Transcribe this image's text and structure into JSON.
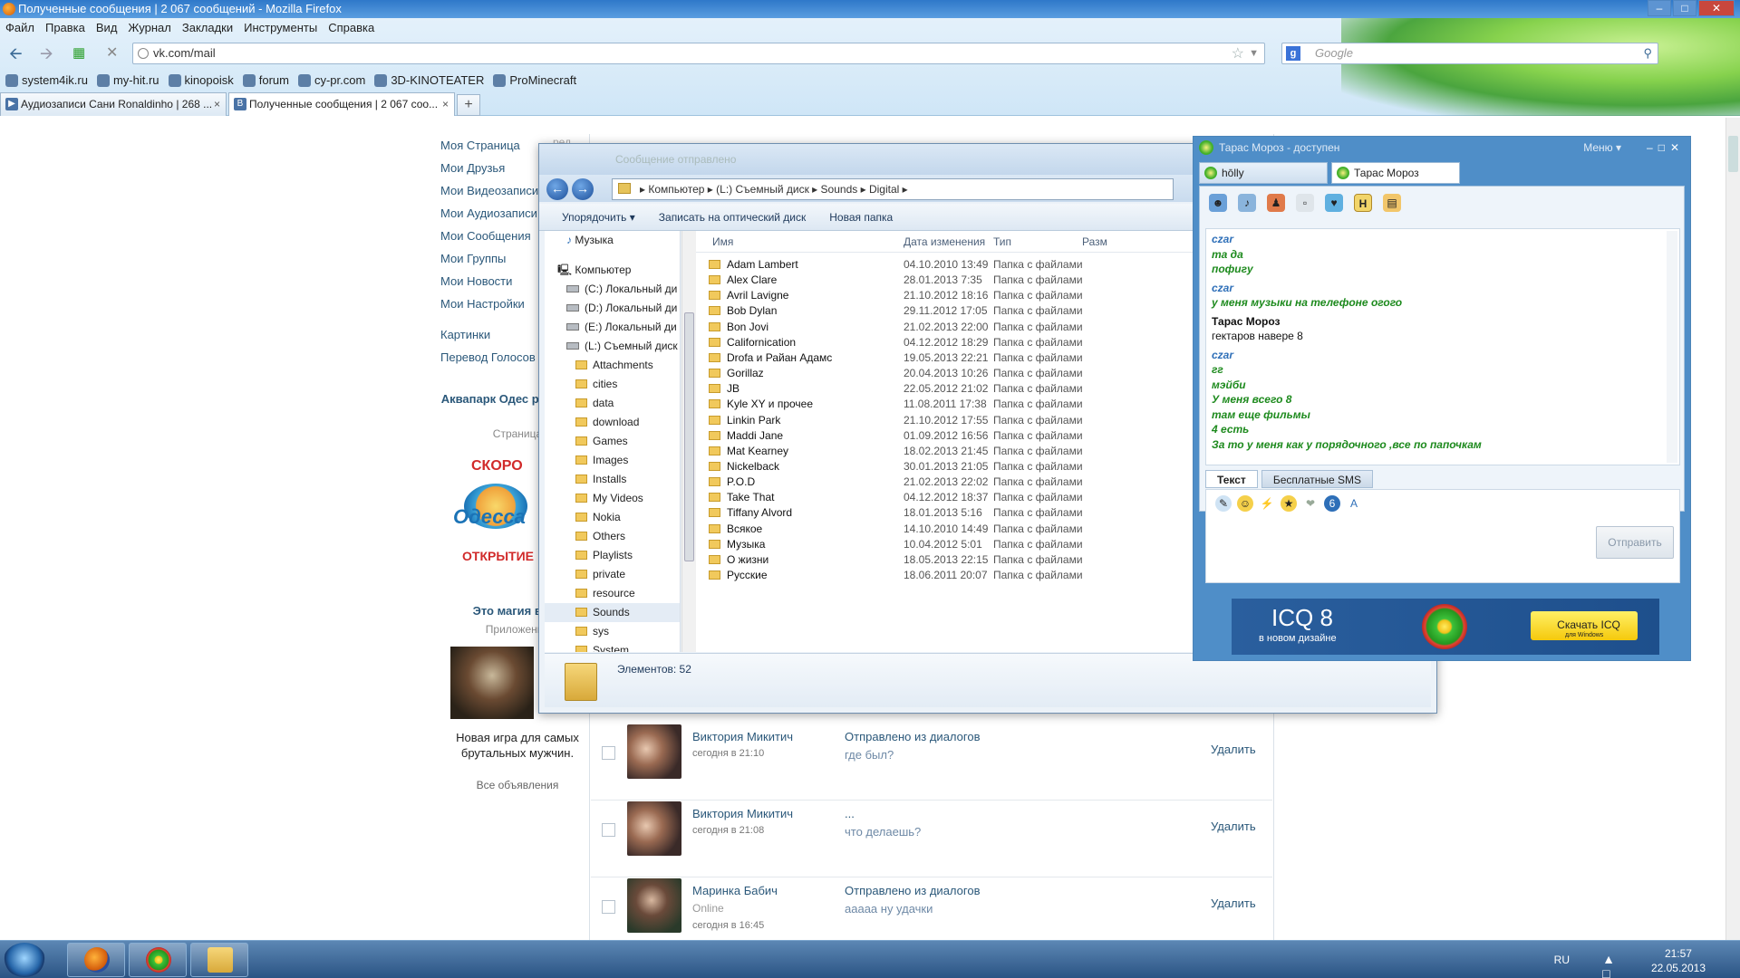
{
  "browser": {
    "window_title": "Полученные сообщения | 2 067 сообщений - Mozilla Firefox",
    "menu": [
      "Файл",
      "Правка",
      "Вид",
      "Журнал",
      "Закладки",
      "Инструменты",
      "Справка"
    ],
    "url": "vk.com/mail",
    "search_placeholder": "Google",
    "bookmarks": [
      "system4ik.ru",
      "my-hit.ru",
      "kinopoisk",
      "forum",
      "cy-pr.com",
      "3D-KINOTEATER",
      "ProMinecraft"
    ],
    "tabs": [
      {
        "label": "Аудиозаписи Сани Ronaldinho | 268 ...",
        "active": false
      },
      {
        "label": "Полученные сообщения | 2 067 соо...",
        "active": true
      }
    ],
    "new_tab": "+"
  },
  "vk": {
    "nav": [
      "Моя Страница",
      "Мои Друзья",
      "Мои Видеозаписи",
      "Мои Аудиозаписи",
      "Мои Сообщения",
      "Мои Группы",
      "Мои Новости",
      "Мои Настройки"
    ],
    "nav2": [
      "Картинки",
      "Перевод Голосов"
    ],
    "partial_tab": "ред",
    "ad1": {
      "title": "Аквапарк Одес розыгрыш",
      "sub": "Страница",
      "img_top": "СКОРО",
      "img_mid": "Одесса",
      "img_bot": "ОТКРЫТИЕ"
    },
    "ad2": {
      "title": "Это магия влас",
      "sub": "Приложение",
      "text": "Новая игра для самых брутальных мужчин."
    },
    "all_ads": "Все объявления",
    "messages": [
      {
        "name": "Виктория Микитич",
        "status": "",
        "time": "сегодня в 21:10",
        "subject": "Отправлено из диалогов",
        "preview": "где был?",
        "delete": "Удалить"
      },
      {
        "name": "Виктория Микитич",
        "status": "",
        "time": "сегодня в 21:08",
        "subject": "...",
        "preview": "что делаешь?",
        "delete": "Удалить"
      },
      {
        "name": "Маринка Бабич",
        "status": "Online",
        "time": "сегодня в 16:45",
        "subject": "Отправлено из диалогов",
        "preview": "ааааа ну удачки",
        "delete": "Удалить"
      }
    ]
  },
  "explorer": {
    "title": "Сообщение отправлено",
    "address": [
      "Компьютер",
      "(L:) Съемный диск",
      "Sounds",
      "Digital"
    ],
    "toolbar": [
      "Упорядочить ▾",
      "Записать на оптический диск",
      "Новая папка"
    ],
    "tree": [
      {
        "label": "Музыка",
        "kind": "music",
        "indent": 1
      },
      {
        "label": "",
        "kind": "gap",
        "indent": 0
      },
      {
        "label": "Компьютер",
        "kind": "computer",
        "indent": 0
      },
      {
        "label": "(C:) Локальный ди",
        "kind": "drive",
        "indent": 1
      },
      {
        "label": "(D:) Локальный ди",
        "kind": "drive",
        "indent": 1
      },
      {
        "label": "(E:) Локальный ди",
        "kind": "drive",
        "indent": 1
      },
      {
        "label": "(L:) Съемный диск",
        "kind": "drive",
        "indent": 1
      },
      {
        "label": "Attachments",
        "kind": "folder",
        "indent": 2
      },
      {
        "label": "cities",
        "kind": "folder",
        "indent": 2
      },
      {
        "label": "data",
        "kind": "folder",
        "indent": 2
      },
      {
        "label": "download",
        "kind": "folder",
        "indent": 2
      },
      {
        "label": "Games",
        "kind": "folder",
        "indent": 2
      },
      {
        "label": "Images",
        "kind": "folder",
        "indent": 2
      },
      {
        "label": "Installs",
        "kind": "folder",
        "indent": 2
      },
      {
        "label": "My Videos",
        "kind": "folder",
        "indent": 2
      },
      {
        "label": "Nokia",
        "kind": "folder",
        "indent": 2
      },
      {
        "label": "Others",
        "kind": "folder",
        "indent": 2
      },
      {
        "label": "Playlists",
        "kind": "folder",
        "indent": 2
      },
      {
        "label": "private",
        "kind": "folder",
        "indent": 2
      },
      {
        "label": "resource",
        "kind": "folder",
        "indent": 2
      },
      {
        "label": "Sounds",
        "kind": "folder",
        "indent": 2,
        "selected": true
      },
      {
        "label": "sys",
        "kind": "folder",
        "indent": 2
      },
      {
        "label": "System",
        "kind": "folder",
        "indent": 2
      }
    ],
    "columns": [
      "Имя",
      "Дата изменения",
      "Тип",
      "Разм"
    ],
    "files": [
      {
        "name": "Adam Lambert",
        "date": "04.10.2010 13:49",
        "type": "Папка с файлами"
      },
      {
        "name": "Alex Clare",
        "date": "28.01.2013 7:35",
        "type": "Папка с файлами"
      },
      {
        "name": "Avril Lavigne",
        "date": "21.10.2012 18:16",
        "type": "Папка с файлами"
      },
      {
        "name": "Bob Dylan",
        "date": "29.11.2012 17:05",
        "type": "Папка с файлами"
      },
      {
        "name": "Bon Jovi",
        "date": "21.02.2013 22:00",
        "type": "Папка с файлами"
      },
      {
        "name": "Californication",
        "date": "04.12.2012 18:29",
        "type": "Папка с файлами"
      },
      {
        "name": "Drofa и Райан Адамс",
        "date": "19.05.2013 22:21",
        "type": "Папка с файлами"
      },
      {
        "name": "Gorillaz",
        "date": "20.04.2013 10:26",
        "type": "Папка с файлами"
      },
      {
        "name": "JB",
        "date": "22.05.2012 21:02",
        "type": "Папка с файлами"
      },
      {
        "name": "Kyle XY и прочее",
        "date": "11.08.2011 17:38",
        "type": "Папка с файлами"
      },
      {
        "name": "Linkin Park",
        "date": "21.10.2012 17:55",
        "type": "Папка с файлами"
      },
      {
        "name": "Maddi Jane",
        "date": "01.09.2012 16:56",
        "type": "Папка с файлами"
      },
      {
        "name": "Mat Kearney",
        "date": "18.02.2013 21:45",
        "type": "Папка с файлами"
      },
      {
        "name": "Nickelback",
        "date": "30.01.2013 21:05",
        "type": "Папка с файлами"
      },
      {
        "name": "P.O.D",
        "date": "21.02.2013 22:02",
        "type": "Папка с файлами"
      },
      {
        "name": "Take That",
        "date": "04.12.2012 18:37",
        "type": "Папка с файлами"
      },
      {
        "name": "Tiffany Alvord",
        "date": "18.01.2013 5:16",
        "type": "Папка с файлами"
      },
      {
        "name": "Всякое",
        "date": "14.10.2010 14:49",
        "type": "Папка с файлами"
      },
      {
        "name": "Музыка",
        "date": "10.04.2012 5:01",
        "type": "Папка с файлами"
      },
      {
        "name": "О жизни",
        "date": "18.05.2013 22:15",
        "type": "Папка с файлами"
      },
      {
        "name": "Русские",
        "date": "18.06.2011 20:07",
        "type": "Папка с файлами"
      }
    ],
    "status": "Элементов: 52"
  },
  "icq": {
    "title": "Тарас Мороз - доступен",
    "menu": "Меню ▾",
    "contacts": [
      "hōlly",
      "Тарас Мороз"
    ],
    "chat": [
      {
        "kind": "cz",
        "text": "czar"
      },
      {
        "kind": "mine",
        "text": "та да"
      },
      {
        "kind": "mine",
        "text": "пофигу"
      },
      {
        "kind": "cz",
        "text": "czar"
      },
      {
        "kind": "mine",
        "text": "у меня музыки на телефоне огого"
      },
      {
        "kind": "tn2",
        "text": "Тарас Мороз"
      },
      {
        "kind": "other",
        "text": "гектаров навере 8"
      },
      {
        "kind": "cz",
        "text": "czar"
      },
      {
        "kind": "mine",
        "text": "гг"
      },
      {
        "kind": "mine",
        "text": "мэйби"
      },
      {
        "kind": "mine",
        "text": "У меня всего 8"
      },
      {
        "kind": "mine",
        "text": "там еще фильмы"
      },
      {
        "kind": "mine",
        "text": "4 есть"
      },
      {
        "kind": "mine",
        "text": "За то у меня как у порядочного ,все по папочкам"
      }
    ],
    "input_tabs": [
      "Текст",
      "Бесплатные SMS"
    ],
    "send": "Отправить",
    "banner": {
      "title": "ICQ 8",
      "sub": "в новом дизайне",
      "download": "Скачать ICQ",
      "download_sub": "для Windows"
    }
  },
  "taskbar": {
    "lang": "RU",
    "time": "21:57",
    "date": "22.05.2013"
  },
  "colors": {
    "vk_link": "#2b587a",
    "icq_blue": "#4f8ec8",
    "taskbar": "#2b5484"
  }
}
